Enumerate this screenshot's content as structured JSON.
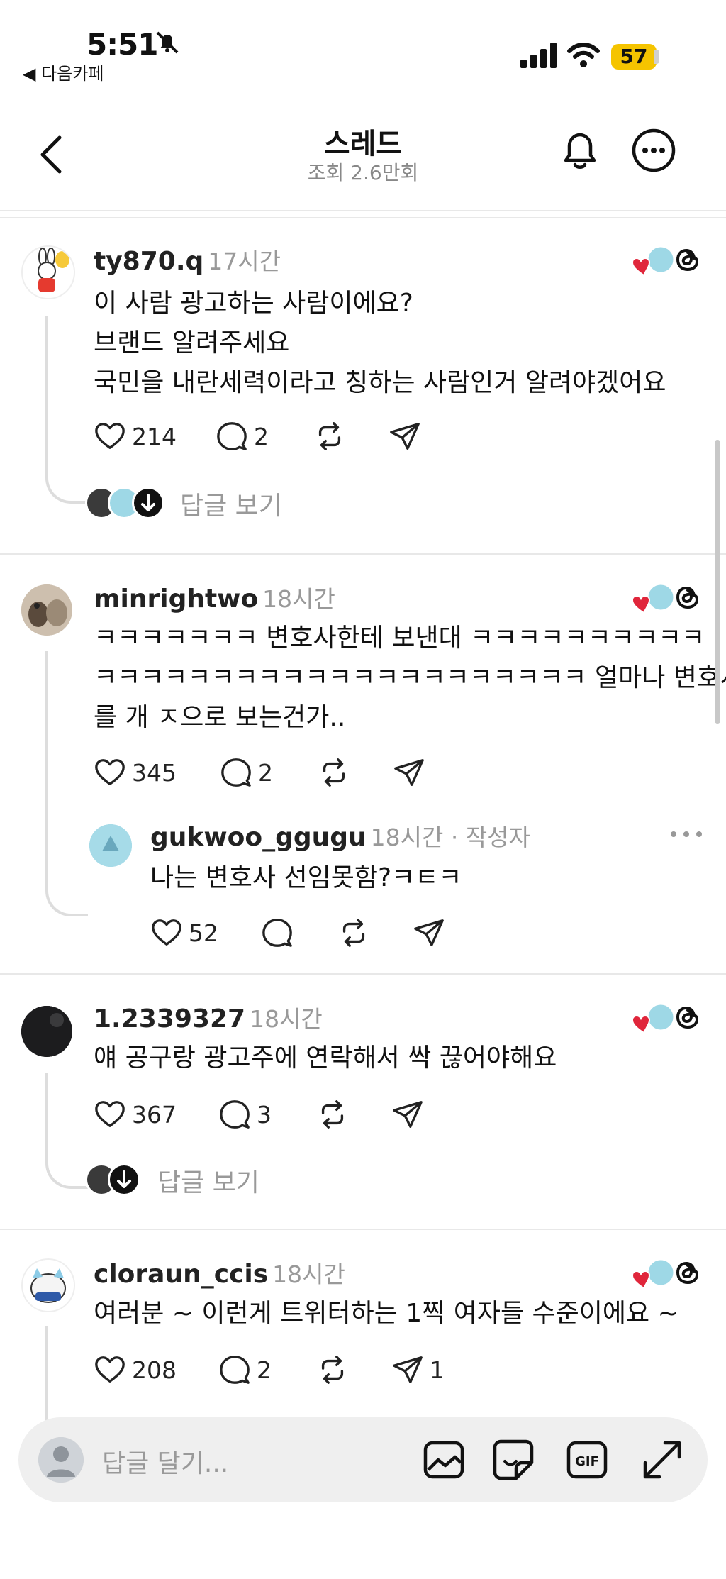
{
  "status_bar": {
    "time": "5:51",
    "back_app": "◀ 다음카페",
    "battery": "57"
  },
  "header": {
    "title": "스레드",
    "subtitle": "조회 2.6만회"
  },
  "comments": [
    {
      "username": "ty870.q",
      "age": "17시간",
      "lines": [
        "이 사람 광고하는 사람이에요?",
        "브랜드 알려주세요",
        "국민을 내란세력이라고 칭하는 사람인거 알려야겠어요"
      ],
      "likes": "214",
      "replies": "2",
      "view_replies": "답글 보기"
    },
    {
      "username": "minrightwo",
      "age": "18시간",
      "lines": [
        "ㅋㅋㅋㅋㅋㅋㅋ 변호사한테 보낸대 ㅋㅋㅋㅋㅋㅋㅋㅋㅋㅋ",
        "ㅋㅋㅋㅋㅋㅋㅋㅋㅋㅋㅋㅋㅋㅋㅋㅋㅋㅋㅋㅋㅋ 얼마나 변호사",
        "를 개 ㅈ으로 보는건가.."
      ],
      "likes": "345",
      "replies": "2",
      "nested": {
        "username": "gukwoo_ggugu",
        "age": "18시간 · 작성자",
        "text": "나는 변호사 선임못함?ㅋㅌㅋ",
        "likes": "52"
      }
    },
    {
      "username": "1.2339327",
      "age": "18시간",
      "lines": [
        "얘 공구랑 광고주에 연락해서 싹 끊어야해요"
      ],
      "likes": "367",
      "replies": "3",
      "view_replies": "답글 보기"
    },
    {
      "username": "cloraun_ccis",
      "age": "18시간",
      "lines": [
        "여러분 ~ 이런게 트위터하는 1찍 여자들 수준이에요 ~"
      ],
      "likes": "208",
      "replies": "2",
      "shares": "1"
    }
  ],
  "reply_box": {
    "placeholder": "답글 달기..."
  }
}
